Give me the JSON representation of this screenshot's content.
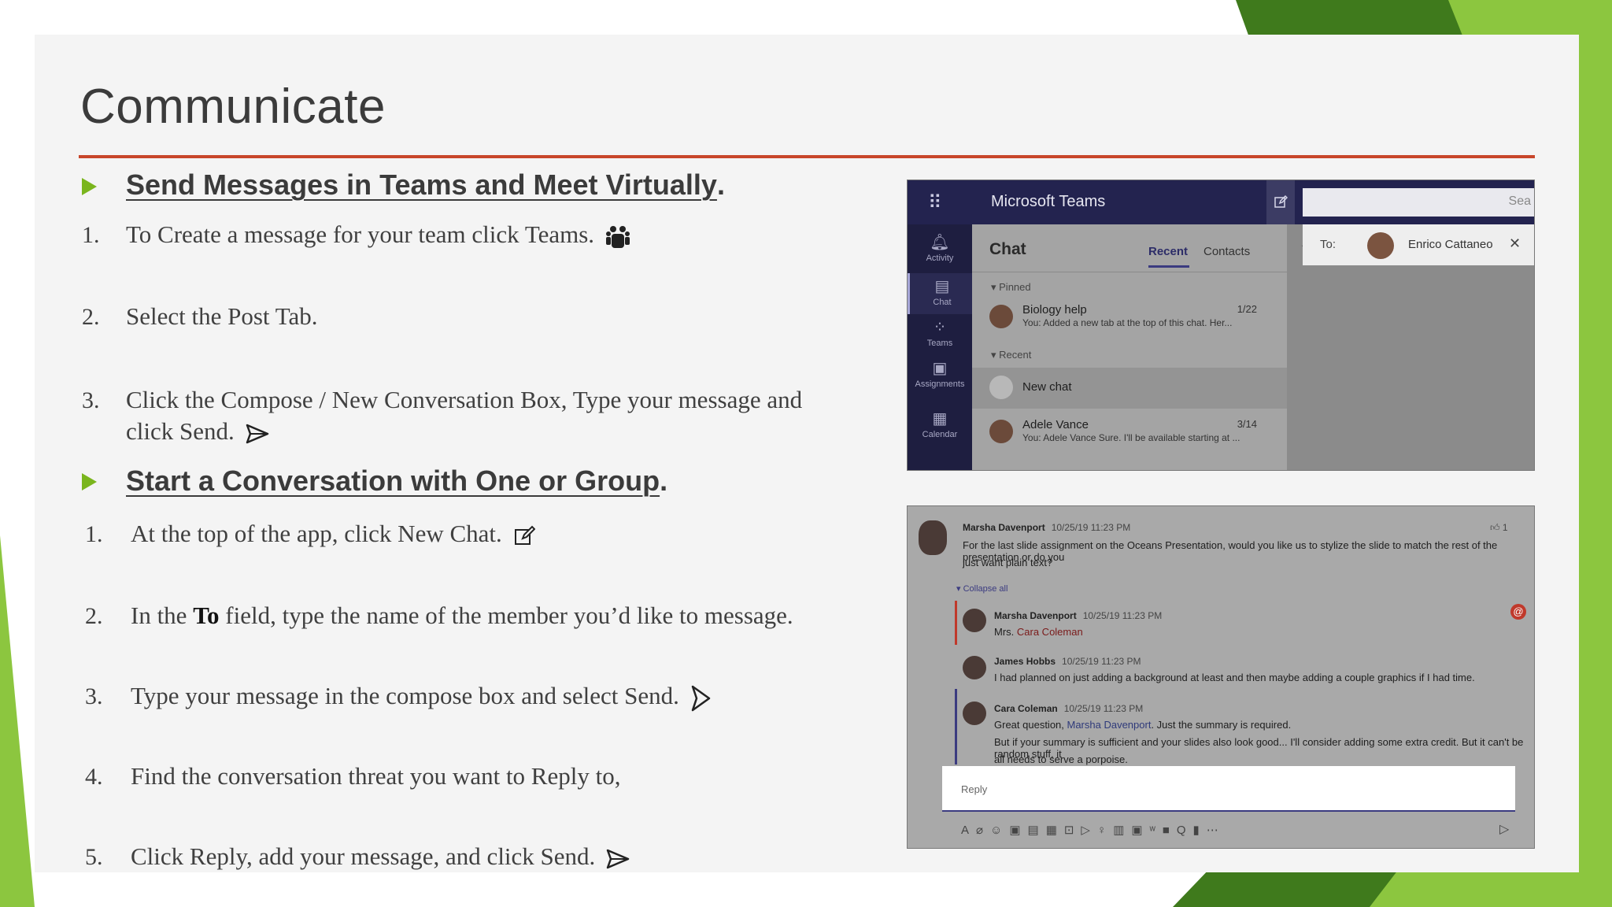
{
  "slide": {
    "title": "Communicate",
    "accent_color": "#7ab51d",
    "rule_color": "#c8462b"
  },
  "section1": {
    "heading": "Send Messages in Teams and Meet Virtually",
    "heading_end": ".",
    "steps": [
      {
        "num": "1.",
        "text": "To Create a message for your team click Teams.",
        "icon": "teams-icon"
      },
      {
        "num": "2.",
        "text": "Select the Post Tab."
      },
      {
        "num": "3.",
        "text": "Click the Compose / New Conversation Box, Type your message and",
        "text2": "click Send.",
        "icon": "send-icon"
      }
    ]
  },
  "section2": {
    "heading": "Start a Conversation with One or Group",
    "heading_end": ".",
    "steps": [
      {
        "num": "1.",
        "text": "At the top of the app, click New Chat.",
        "icon": "new-chat-icon"
      },
      {
        "num": "2.",
        "text_pre": "In the ",
        "bold": "To",
        "text": " field, type the name of the member you’d like to message."
      },
      {
        "num": "3.",
        "text": "Type your message in the compose box and select Send.",
        "icon": "send-icon"
      },
      {
        "num": "4.",
        "text": "Find the conversation threat you want to Reply to,"
      },
      {
        "num": "5.",
        "text": "Click Reply, add your message, and click Send.",
        "icon": "send-icon"
      }
    ]
  },
  "screenshot1": {
    "app_name": "Microsoft Teams",
    "search_placeholder": "Sea",
    "rail": [
      {
        "label": "Activity",
        "icon": "bell-icon"
      },
      {
        "label": "Chat",
        "icon": "chat-icon"
      },
      {
        "label": "Teams",
        "icon": "teams-icon"
      },
      {
        "label": "Assignments",
        "icon": "bag-icon"
      },
      {
        "label": "Calendar",
        "icon": "calendar-icon"
      }
    ],
    "panel_title": "Chat",
    "tabs": [
      "Recent",
      "Contacts"
    ],
    "sections": [
      "Pinned",
      "Recent"
    ],
    "items": [
      {
        "name": "Biology help",
        "preview": "You: Added a new tab at the top of this chat. Her...",
        "date": "1/22"
      },
      {
        "name": "New chat",
        "preview": "",
        "date": ""
      },
      {
        "name": "Adele Vance",
        "preview": "You: Adele Vance Sure. I'll be available starting at ...",
        "date": "3/14"
      }
    ],
    "to_label": "To:",
    "to_name": "Enrico Cattaneo"
  },
  "screenshot2": {
    "likes": "1",
    "collapse": "Collapse all",
    "reply_placeholder": "Reply",
    "messages": [
      {
        "author": "Marsha Davenport",
        "time": "10/25/19 11:23 PM",
        "lines": [
          "For the last slide assignment on the Oceans Presentation, would you like us to stylize the slide to match the rest of the presentation or do you",
          "just want plain text?"
        ]
      },
      {
        "author": "Marsha Davenport",
        "time": "10/25/19 11:23 PM",
        "prefix": "Mrs. ",
        "mention": "Cara Coleman"
      },
      {
        "author": "James Hobbs",
        "time": "10/25/19 11:23 PM",
        "lines": [
          "I had planned on just adding a background at least and then maybe adding a couple graphics if I had time."
        ]
      },
      {
        "author": "Cara Coleman",
        "time": "10/25/19 11:23 PM",
        "line1_pre": "Great question, ",
        "line1_link": "Marsha Davenport",
        "line1_post": ". Just the summary is required.",
        "lines": [
          "But if your summary is sufficient and your slides also look good... I'll consider adding some extra credit. But it can't be random stuff, it",
          "all needs to serve a porpoise."
        ]
      }
    ]
  }
}
